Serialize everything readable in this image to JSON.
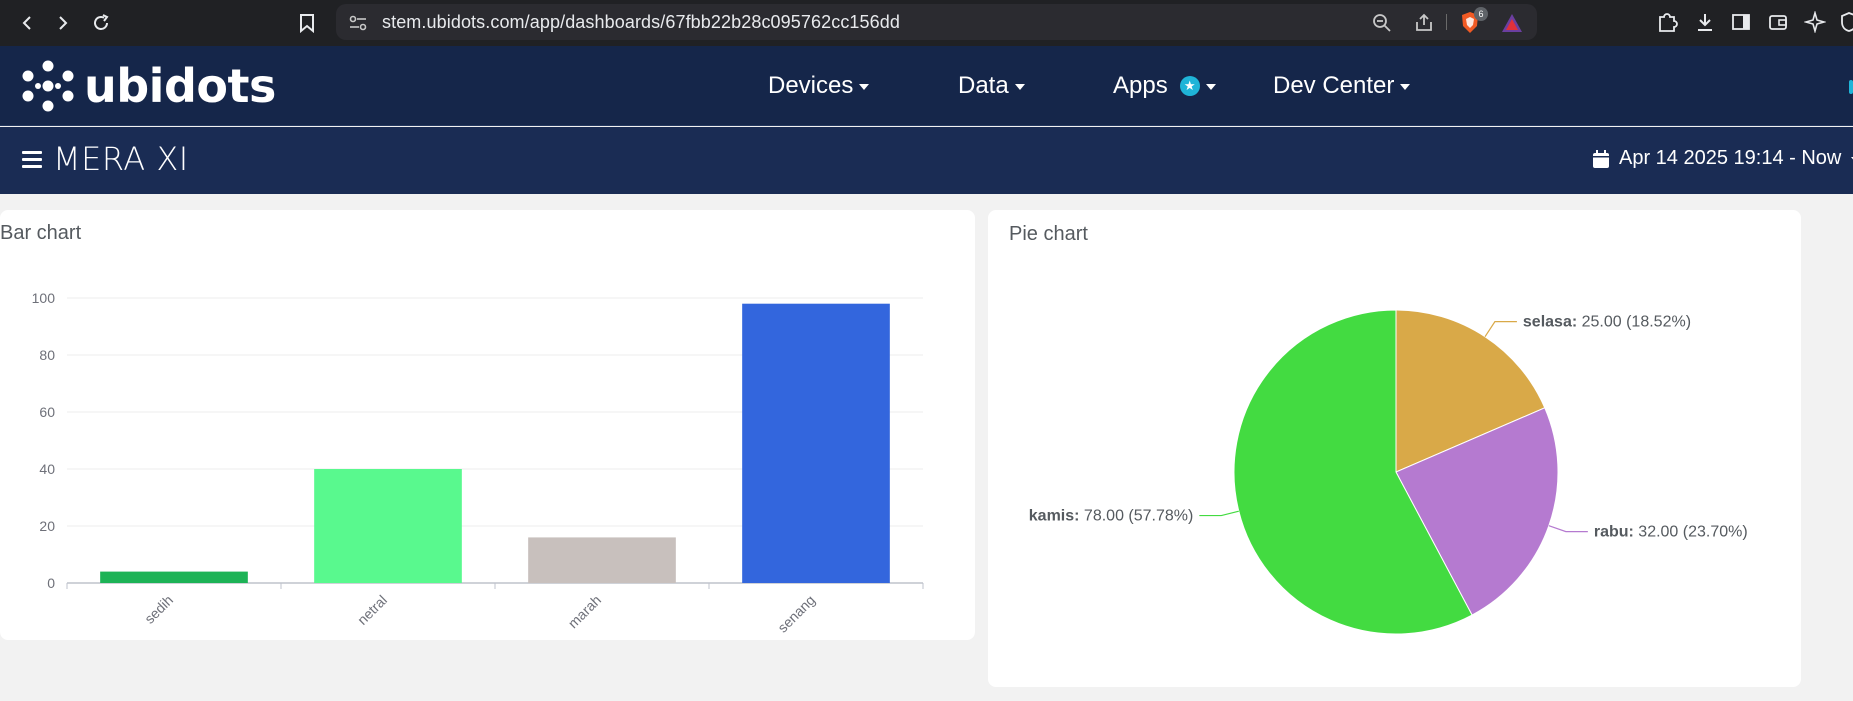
{
  "browser": {
    "url": "stem.ubidots.com/app/dashboards/67fbb22b28c095762cc156dd",
    "badge_count": "6"
  },
  "nav": {
    "logo": "ubidots",
    "items": [
      {
        "label": "Devices"
      },
      {
        "label": "Data"
      },
      {
        "label": "Apps"
      },
      {
        "label": "Dev Center"
      }
    ]
  },
  "dashboard": {
    "title": "MERA XI",
    "date_range": "Apr 14 2025 19:14 - Now"
  },
  "bar_widget": {
    "title": "Bar chart"
  },
  "pie_widget": {
    "title": "Pie chart"
  },
  "colors": {
    "nav_bg": "#15264a",
    "dash_bg": "#1a2c54"
  },
  "chart_data": [
    {
      "type": "bar",
      "title": "Bar chart",
      "categories": [
        "sedih",
        "netral",
        "marah",
        "senang"
      ],
      "values": [
        4,
        40,
        16,
        98
      ],
      "colors": [
        "#1db356",
        "#59f98e",
        "#c8c0bd",
        "#3366dd"
      ],
      "ylim": [
        0,
        100
      ],
      "yticks": [
        0,
        20,
        40,
        60,
        80,
        100
      ],
      "grid": true
    },
    {
      "type": "pie",
      "title": "Pie chart",
      "slices": [
        {
          "label": "selasa",
          "value": 25.0,
          "percent": "18.52%",
          "text": "25.00 (18.52%)",
          "color": "#d9a948"
        },
        {
          "label": "rabu",
          "value": 32.0,
          "percent": "23.70%",
          "text": "32.00 (23.70%)",
          "color": "#b57ad0"
        },
        {
          "label": "kamis",
          "value": 78.0,
          "percent": "57.78%",
          "text": "78.00 (57.78%)",
          "color": "#43db41"
        }
      ]
    }
  ]
}
